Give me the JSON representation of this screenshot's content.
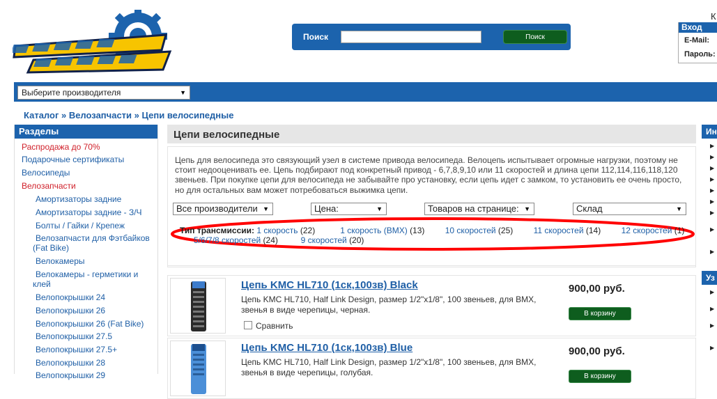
{
  "header": {
    "corner_letter": "К",
    "search": {
      "label": "Поиск",
      "value": "",
      "placeholder": "",
      "button": "Поиск"
    },
    "login": {
      "title": "Вход",
      "email_label": "E-Mail:",
      "password_label": "Пароль:"
    }
  },
  "manufacturer_select": {
    "value": "Выберите производителя"
  },
  "breadcrumb": "Каталог » Велозапчасти » Цепи велосипедные",
  "sidebar": {
    "title": "Разделы",
    "items": [
      {
        "label": "Распродажа до 70%"
      },
      {
        "label": "Подарочные сертификаты"
      },
      {
        "label": "Велосипеды"
      },
      {
        "label": "Велозапчасти"
      },
      {
        "label": "Амортизаторы задние"
      },
      {
        "label": "Амортизаторы задние - З/Ч"
      },
      {
        "label": "Болты / Гайки / Крепеж"
      },
      {
        "label": "Велозапчасти для Фэтбайков"
      },
      {
        "label": "(Fat Bike)"
      },
      {
        "label": "Велокамеры"
      },
      {
        "label": "Велокамеры - герметики и"
      },
      {
        "label": "клей"
      },
      {
        "label": "Велопокрышки 24"
      },
      {
        "label": "Велопокрышки 26"
      },
      {
        "label": "Велопокрышки 26 (Fat Bike)"
      },
      {
        "label": "Велопокрышки 27.5"
      },
      {
        "label": "Велопокрышки 27.5+"
      },
      {
        "label": "Велопокрышки 28"
      },
      {
        "label": "Велопокрышки 29"
      }
    ]
  },
  "main": {
    "title": "Цепи велосипедные",
    "description": "Цепь для велосипеда это связующий узел в системе привода велосипеда. Велоцепь испытывает огромные нагрузки, поэтому не стоит недооценивать ее. Цепь подбирают под конкретный привод - 6,7,8,9,10 или 11 скоростей и длина цепи 112,114,116,118,120 звеньев. При покупке цепи для велосипеда не забывайте про установку, если цепь идет с замком, то установить ее очень просто, но для остальных вам может потребоваться выжимка цепи.",
    "filters": {
      "manufacturers": "Все производители",
      "price": "Цена:",
      "per_page": "Товаров на странице:",
      "stock": "Склад"
    },
    "transmission": {
      "label": "Тип трансмиссии:",
      "options": [
        {
          "name": "1 скорость",
          "count": "(22)"
        },
        {
          "name": "1 скорость (BMX)",
          "count": "(13)"
        },
        {
          "name": "10 скоростей",
          "count": "(25)"
        },
        {
          "name": "11 скоростей",
          "count": "(14)"
        },
        {
          "name": "12 скоростей",
          "count": "(1)"
        },
        {
          "name": "5/6/7/8 скоростей",
          "count": "(24)"
        },
        {
          "name": "9 скоростей",
          "count": "(20)"
        }
      ]
    },
    "highlight_color": "#ff0000",
    "products": [
      {
        "title": "Цепь KMC HL710 (1ск,100зв) Black",
        "description": "Цепь KMC HL710, Half Link Design, размер 1/2\"x1/8\", 100 звеньев, для BMX, звенья в виде черепицы, черная.",
        "compare": "Сравнить",
        "price": "900,00 руб.",
        "cart": "В корзину"
      },
      {
        "title": "Цепь KMC HL710 (1ск,100зв) Blue",
        "description": "Цепь KMC HL710, Half Link Design, размер 1/2\"x1/8\", 100 звеньев, для BMX, звенья в виде черепицы, голубая.",
        "compare": "Сравнить",
        "price": "900,00 руб.",
        "cart": "В корзину"
      }
    ]
  },
  "right_sidebar": {
    "info_title": "Ин",
    "second_title": "Уз"
  },
  "colors": {
    "brand_blue": "#1c63ad",
    "sale_red": "#d0202a",
    "cart_green": "#0e5d1e"
  }
}
